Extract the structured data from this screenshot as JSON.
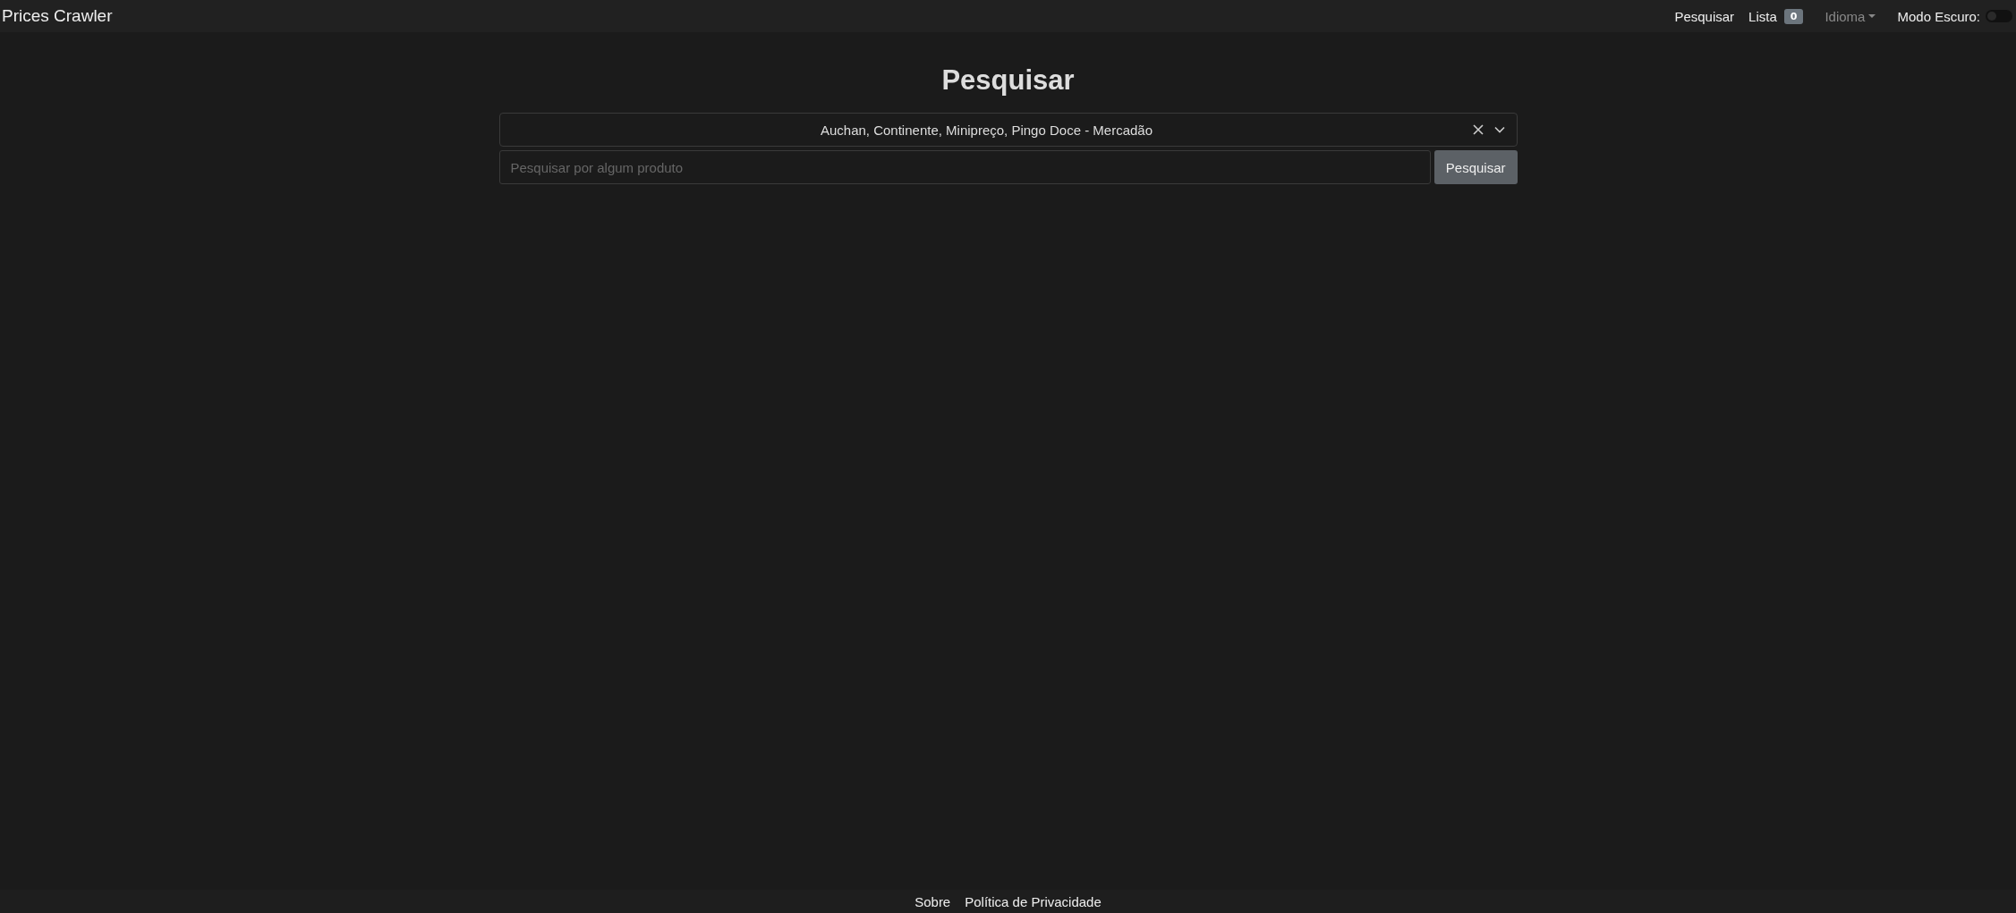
{
  "navbar": {
    "brand": "Prices Crawler",
    "links": [
      {
        "kind": "link",
        "label": "Pesquisar"
      },
      {
        "kind": "badge",
        "label": "Lista",
        "badge": "0"
      },
      {
        "kind": "dropdown",
        "label": "Idioma"
      }
    ],
    "dark_mode": {
      "label": "Modo Escuro:",
      "on": false
    }
  },
  "heading": "Pesquisar",
  "store_select": {
    "value": "Auchan, Continente, Minipreço, Pingo Doce - Mercadão"
  },
  "search": {
    "placeholder": "Pesquisar por algum produto",
    "button": "Pesquisar"
  },
  "footer": {
    "links": [
      "Sobre",
      "Política de Privacidade"
    ]
  }
}
